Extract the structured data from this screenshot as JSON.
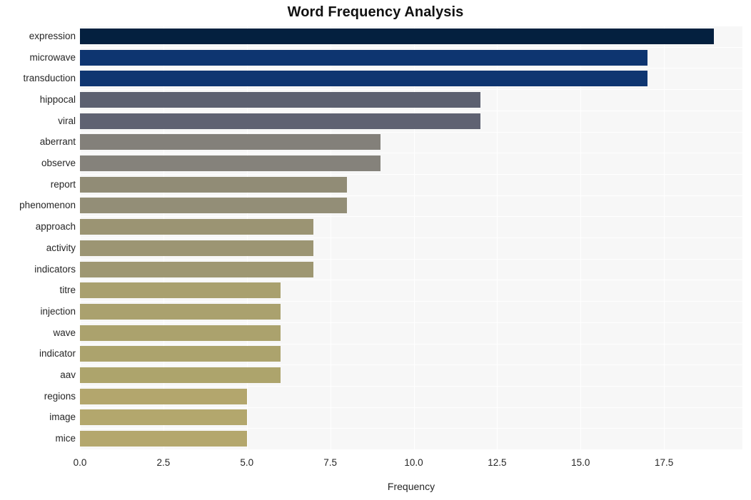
{
  "chart_data": {
    "type": "bar",
    "orientation": "horizontal",
    "title": "Word Frequency Analysis",
    "xlabel": "Frequency",
    "ylabel": "",
    "categories": [
      "expression",
      "microwave",
      "transduction",
      "hippocal",
      "viral",
      "aberrant",
      "observe",
      "report",
      "phenomenon",
      "approach",
      "activity",
      "indicators",
      "titre",
      "injection",
      "wave",
      "indicator",
      "aav",
      "regions",
      "image",
      "mice"
    ],
    "values": [
      19,
      17,
      17,
      12,
      12,
      9,
      9,
      8,
      8,
      7,
      7,
      7,
      6,
      6,
      6,
      6,
      6,
      5,
      5,
      5
    ],
    "bar_colors": [
      "#04203f",
      "#0e3570",
      "#0f3671",
      "#5c6070",
      "#5f6272",
      "#83807a",
      "#85827b",
      "#918c76",
      "#938e77",
      "#9b9473",
      "#9c9573",
      "#9e9772",
      "#a9a06e",
      "#aaa16e",
      "#aba26d",
      "#aca36d",
      "#ada46c",
      "#b3a66d",
      "#b3a76d",
      "#b4a76d"
    ],
    "xticks": [
      "0.0",
      "2.5",
      "5.0",
      "7.5",
      "10.0",
      "12.5",
      "15.0",
      "17.5"
    ],
    "xtick_values": [
      0.0,
      2.5,
      5.0,
      7.5,
      10.0,
      12.5,
      15.0,
      17.5
    ],
    "xlim": [
      0,
      19.85
    ],
    "grid": true,
    "grid_color": "#ffffff",
    "plot_background": "#f7f7f7",
    "figure_background": "#ffffff",
    "legend": null
  }
}
